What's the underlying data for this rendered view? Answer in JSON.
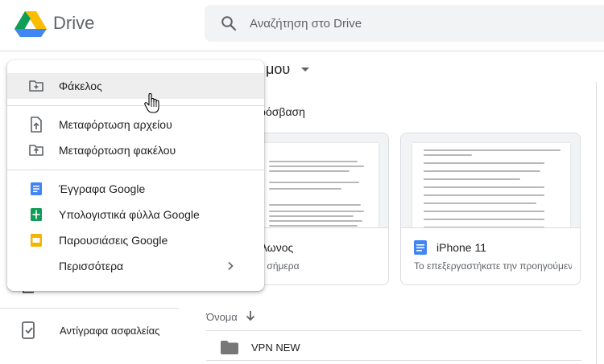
{
  "header": {
    "brand": "Drive",
    "search_placeholder": "Αναζήτηση στο Drive"
  },
  "main": {
    "title": "μου",
    "quick_access": "ρόσβαση",
    "cards": [
      {
        "name": "κλωνος",
        "subtitle": "τε σήμερα"
      },
      {
        "name": "iPhone 11",
        "subtitle": "Το επεξεργαστήκατε την προηγούμενη"
      }
    ],
    "column_name": "Όνομα",
    "rows": [
      {
        "name": "VPN NEW"
      }
    ]
  },
  "sidebar": {
    "backup_label": "Αντίγραφα ασφαλείας"
  },
  "new_menu": {
    "items": [
      {
        "label": "Φάκελος",
        "icon": "new-folder-icon"
      },
      {
        "label": "Μεταφόρτωση αρχείου",
        "icon": "upload-file-icon"
      },
      {
        "label": "Μεταφόρτωση φακέλου",
        "icon": "upload-folder-icon"
      },
      {
        "label": "Έγγραφα Google",
        "icon": "google-docs-icon"
      },
      {
        "label": "Υπολογιστικά φύλλα Google",
        "icon": "google-sheets-icon"
      },
      {
        "label": "Παρουσιάσεις Google",
        "icon": "google-slides-icon"
      },
      {
        "label": "Περισσότερα",
        "icon": "chevron-right-icon"
      }
    ]
  },
  "colors": {
    "docs_blue": "#4285f4",
    "sheets_green": "#0f9d58",
    "slides_yellow": "#f4b400",
    "hover_gray": "#eeeeee",
    "icon_gray": "#5f6368"
  }
}
